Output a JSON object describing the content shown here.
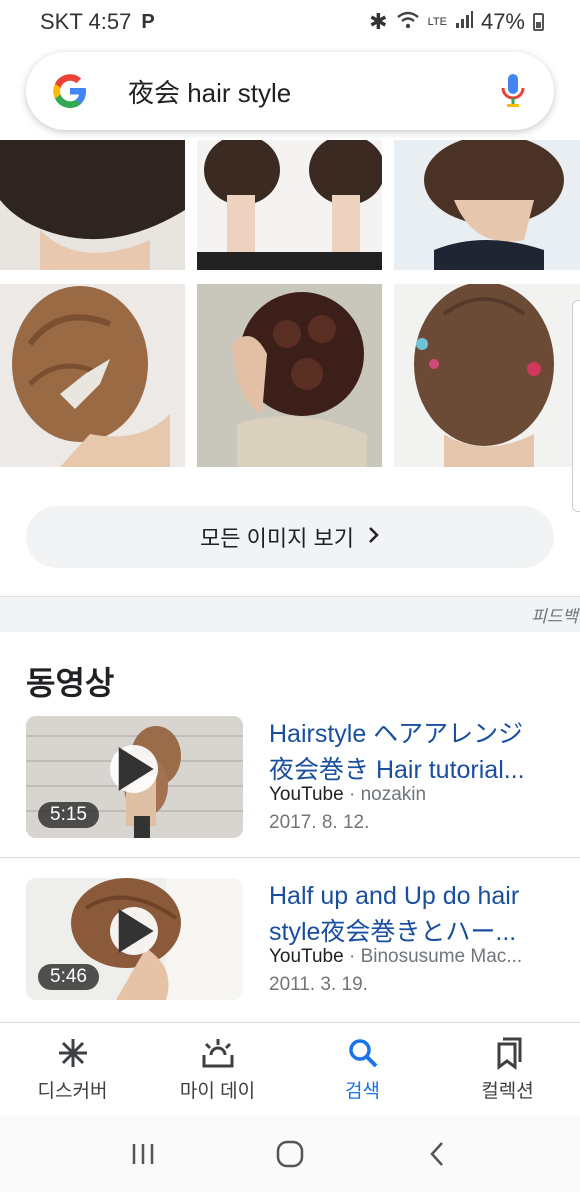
{
  "status_bar": {
    "carrier_time": "SKT 4:57",
    "p_indicator": "P",
    "network": "LTE",
    "battery": "47%"
  },
  "search": {
    "query": "夜会 hair style",
    "logo": "G"
  },
  "images": {
    "see_all_label": "모든 이미지 보기",
    "see_all_chevron": "›"
  },
  "feedback": "피드백",
  "videos": {
    "section_title": "동영상",
    "items": [
      {
        "title_line1": "Hairstyle ヘアアレンジ",
        "title_line2": "夜会巻き Hair tutorial...",
        "source": "YouTube",
        "channel": "nozakin",
        "date": "2017. 8. 12.",
        "duration": "5:15"
      },
      {
        "title_line1": "Half up and Up do hair",
        "title_line2": "style夜会巻きとハー...",
        "source": "YouTube",
        "channel": "Binosusume Mac...",
        "date": "2011. 3. 19.",
        "duration": "5:46"
      }
    ]
  },
  "bottom_nav": [
    {
      "label": "디스커버",
      "icon": "asterisk-icon"
    },
    {
      "label": "마이 데이",
      "icon": "sunrise-icon"
    },
    {
      "label": "검색",
      "icon": "search-icon",
      "active": true
    },
    {
      "label": "컬렉션",
      "icon": "collections-icon"
    }
  ],
  "colors": {
    "link_blue": "#1a4fa0",
    "active_blue": "#1a73e8",
    "chip_bg": "#f1f3f4"
  }
}
